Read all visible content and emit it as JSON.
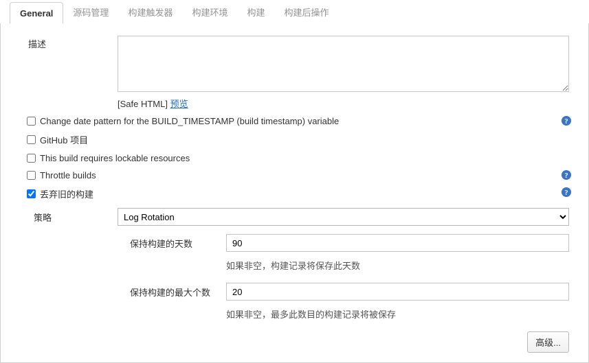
{
  "tabs": {
    "general": "General",
    "scm": "源码管理",
    "triggers": "构建触发器",
    "env": "构建环境",
    "build": "构建",
    "post": "构建后操作"
  },
  "desc": {
    "label": "描述",
    "value": "",
    "safehtml": "[Safe HTML]",
    "preview": "预览"
  },
  "options": {
    "change_timestamp": {
      "label": "Change date pattern for the BUILD_TIMESTAMP (build timestamp) variable",
      "checked": false,
      "help": true
    },
    "github_project": {
      "label": "GitHub 项目",
      "checked": false,
      "help": false
    },
    "lockable": {
      "label": "This build requires lockable resources",
      "checked": false,
      "help": false
    },
    "throttle": {
      "label": "Throttle builds",
      "checked": false,
      "help": true
    },
    "discard_old": {
      "label": "丢弃旧的构建",
      "checked": true,
      "help": true
    }
  },
  "strategy": {
    "label": "策略",
    "selected": "Log Rotation",
    "days_label": "保持构建的天数",
    "days_value": "90",
    "days_hint": "如果非空，构建记录将保存此天数",
    "max_label": "保持构建的最大个数",
    "max_value": "20",
    "max_hint": "如果非空，最多此数目的构建记录将被保存"
  },
  "advanced_btn": "高级..."
}
